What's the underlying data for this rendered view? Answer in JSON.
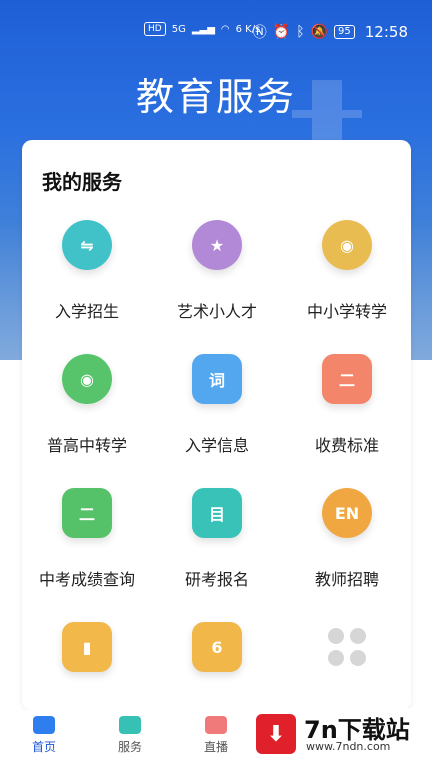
{
  "status": {
    "left_icons": [
      "HD",
      "5G",
      "signal",
      "wifi"
    ],
    "speed": "6 K/s",
    "battery": "95",
    "time": "12:58"
  },
  "page_title": "教育服务",
  "section_title": "我的服务",
  "services": [
    {
      "label": "入学招生",
      "icon": "exchange-icon",
      "color": "#41c2c9",
      "glyph": "⇋"
    },
    {
      "label": "艺术小人才",
      "icon": "star-icon",
      "color": "#b289d6",
      "glyph": "★"
    },
    {
      "label": "中小学转学",
      "icon": "eye-icon",
      "color": "#e9bc52",
      "glyph": "◉"
    },
    {
      "label": "普高中转学",
      "icon": "eye-icon",
      "color": "#57c46b",
      "glyph": "◉"
    },
    {
      "label": "入学信息",
      "icon": "word-icon",
      "color": "#52a7ef",
      "glyph": "词"
    },
    {
      "label": "收费标准",
      "icon": "fee-icon",
      "color": "#f3866a",
      "glyph": "二"
    },
    {
      "label": "中考成绩查询",
      "icon": "clipboard-icon",
      "color": "#55c168",
      "glyph": "二"
    },
    {
      "label": "研考报名",
      "icon": "document-icon",
      "color": "#39c2b8",
      "glyph": "目"
    },
    {
      "label": "教师招聘",
      "icon": "english-icon",
      "color": "#f0a741",
      "glyph": "EN"
    },
    {
      "label": "",
      "icon": "book-icon",
      "color": "#f2b84a",
      "glyph": "▮"
    },
    {
      "label": "",
      "icon": "calendar-icon",
      "color": "#f1b749",
      "glyph": "6"
    },
    {
      "label": "",
      "icon": "more-apps-icon",
      "color": "#d9d9d9",
      "glyph": ""
    }
  ],
  "tabs": [
    {
      "label": "首页",
      "active": true
    },
    {
      "label": "服务",
      "active": false
    },
    {
      "label": "直播",
      "active": false
    }
  ],
  "watermark": {
    "brand": "7n下载站",
    "url": "www.7ndn.com"
  }
}
